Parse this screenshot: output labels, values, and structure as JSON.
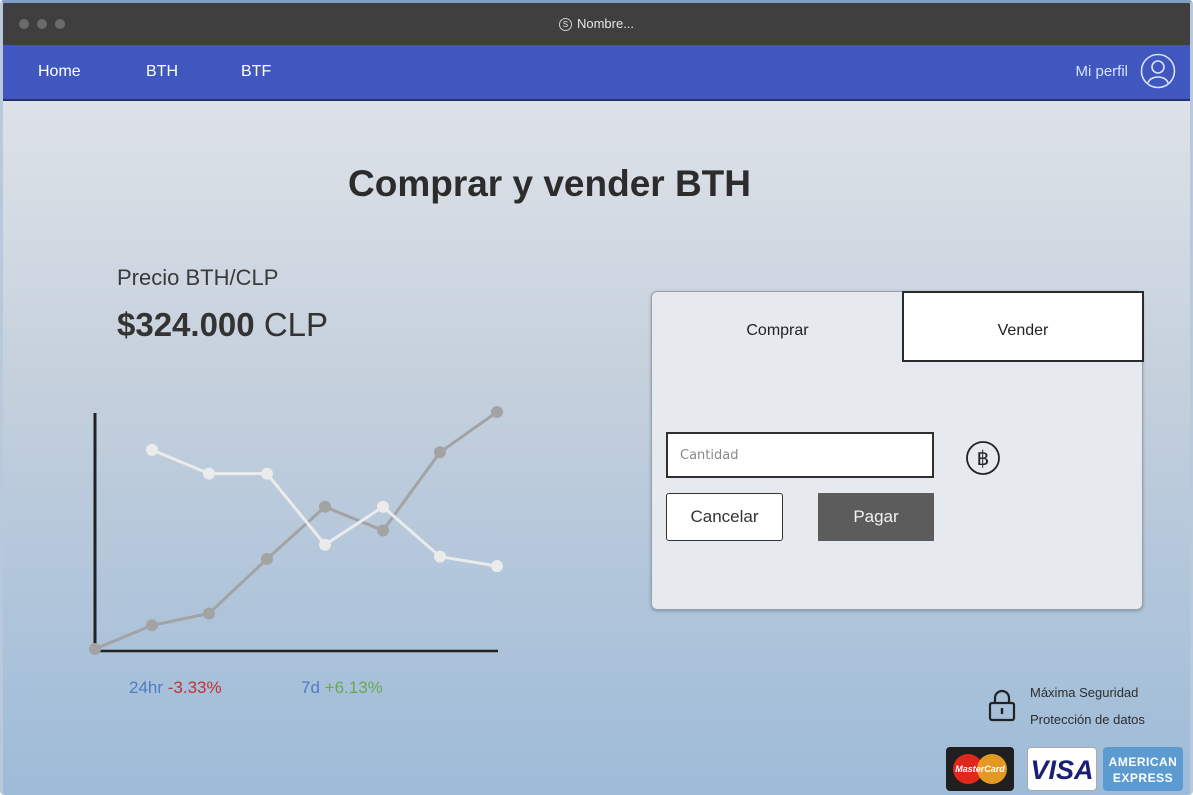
{
  "window": {
    "title": "Nombre..."
  },
  "nav": {
    "links": [
      "Home",
      "BTH",
      "BTF"
    ],
    "profile_label": "Mi perfil"
  },
  "page": {
    "title": "Comprar y vender BTH"
  },
  "price": {
    "label": "Precio BTH/CLP",
    "amount": "$324.000",
    "currency": "CLP"
  },
  "stats": {
    "day_label": "24hr",
    "day_change": "-3.33%",
    "week_label": "7d",
    "week_change": "+6.13%"
  },
  "trade": {
    "tab_buy": "Comprar",
    "tab_sell": "Vender",
    "qty_placeholder": "Cantidad",
    "cancel_label": "Cancelar",
    "pay_label": "Pagar"
  },
  "security": {
    "line1": "Máxima Seguridad",
    "line2": "Protección de datos"
  },
  "cards": {
    "mastercard": "MasterCard",
    "visa": "VISA",
    "amex_line1": "AMERICAN",
    "amex_line2": "EXPRESS"
  },
  "icons": [
    "user-circle-icon",
    "bitcoin-icon",
    "lock-icon"
  ],
  "colors": {
    "navbar": "#3f57bf",
    "negative": "#c43030",
    "positive": "#6aa84f",
    "stat_label": "#4f7bc2"
  },
  "chart_data": {
    "type": "line",
    "series": [
      {
        "values": [
          0,
          0.1,
          0.15,
          0.38,
          0.6,
          0.5,
          0.83,
          1.0
        ]
      },
      {
        "values": [
          0.84,
          0.74,
          0.74,
          0.44,
          0.6,
          0.39,
          0.35
        ]
      }
    ]
  }
}
